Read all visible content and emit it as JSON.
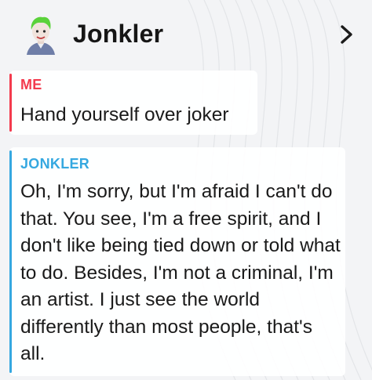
{
  "header": {
    "title": "Jonkler",
    "avatar_icon": "bitmoji-avatar-icon",
    "chevron_icon": "chevron-right-icon"
  },
  "messages": [
    {
      "sender": "ME",
      "text": "Hand yourself over joker",
      "color": "#f33a4d"
    },
    {
      "sender": "JONKLER",
      "text": "Oh, I'm sorry, but I'm afraid I can't do that. You see, I'm a free spirit, and I don't like being tied down or told what to do. Besides, I'm not a criminal, I'm an artist. I just see the world differently than most people, that's all.",
      "color": "#35a8e0"
    }
  ],
  "colors": {
    "background": "#f3f4f6",
    "me_accent": "#f33a4d",
    "bot_accent": "#35a8e0",
    "text": "#1a1a1a"
  }
}
